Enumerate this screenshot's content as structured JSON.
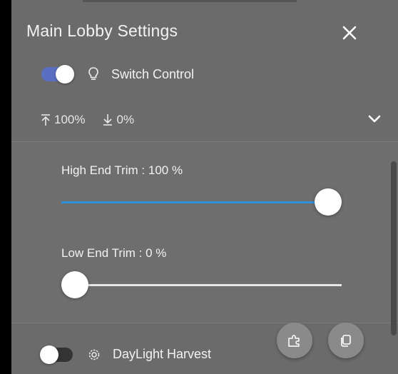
{
  "header": {
    "title": "Main Lobby Settings"
  },
  "switch_control": {
    "label": "Switch Control",
    "enabled": true,
    "icon": "lightbulb-icon"
  },
  "levels": {
    "high": "100%",
    "low": "0%"
  },
  "high_end_trim": {
    "label": "High End Trim : 100 %",
    "value_percent": 100
  },
  "low_end_trim": {
    "label": "Low End Trim : 0 %",
    "value_percent": 0
  },
  "daylight_harvest": {
    "label": "DayLight Harvest",
    "enabled": false,
    "icon": "gear-icon"
  },
  "actions": {
    "plugin_icon": "puzzle-icon",
    "copy_icon": "copy-icon"
  },
  "colors": {
    "panel_bg": "#6b6b6b",
    "toggle_on": "#5b6fc2",
    "slider_fill": "#2f8fd8"
  }
}
